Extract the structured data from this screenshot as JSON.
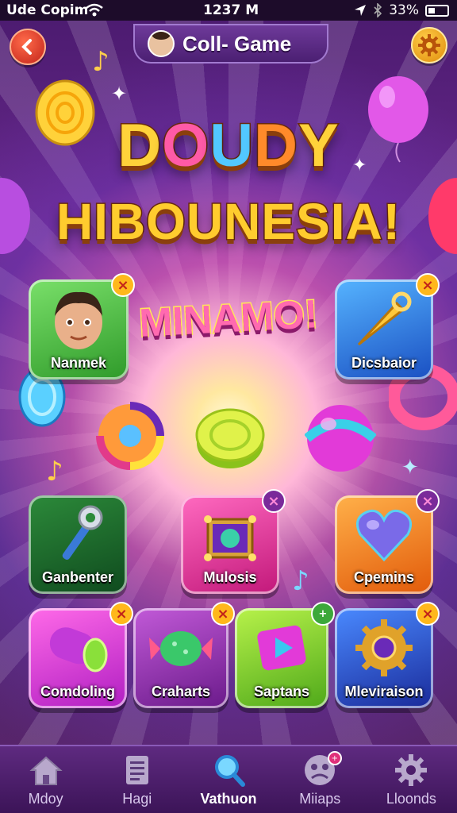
{
  "status_bar": {
    "carrier": "Ude Copim",
    "time": "1237 M",
    "battery": "33%"
  },
  "header": {
    "title": "Coll- Game"
  },
  "banner": {
    "line1": [
      "D",
      "O",
      "U",
      "D",
      "Y"
    ],
    "line2": "HIBOUNESIA!",
    "subtitle": "MINAMO!"
  },
  "tiles": [
    {
      "label": "Nanmek",
      "icon": "avatar-boy-icon",
      "badge": "×"
    },
    {
      "label": "Dicsbaior",
      "icon": "golden-horn-icon",
      "badge": "×"
    },
    {
      "label": "Ganbenter",
      "icon": "wrench-icon",
      "badge": ""
    },
    {
      "label": "Mulosis",
      "icon": "treasure-box-icon",
      "badge": "×"
    },
    {
      "label": "Cpemins",
      "icon": "heart-icon",
      "badge": "×"
    },
    {
      "label": "Comdoling",
      "icon": "tube-candy-icon",
      "badge": "×"
    },
    {
      "label": "Craharts",
      "icon": "wrapped-candy-icon",
      "badge": "×"
    },
    {
      "label": "Saptans",
      "icon": "play-gem-icon",
      "badge": "+"
    },
    {
      "label": "Mleviraison",
      "icon": "golden-gear-icon",
      "badge": "×"
    }
  ],
  "nav": [
    {
      "label": "Mdoy",
      "icon": "home-icon"
    },
    {
      "label": "Hagi",
      "icon": "document-icon"
    },
    {
      "label": "Vathuon",
      "icon": "search-icon",
      "active": true
    },
    {
      "label": "Miiaps",
      "icon": "face-icon",
      "badge": "+"
    },
    {
      "label": "Lloonds",
      "icon": "gear-icon"
    }
  ]
}
